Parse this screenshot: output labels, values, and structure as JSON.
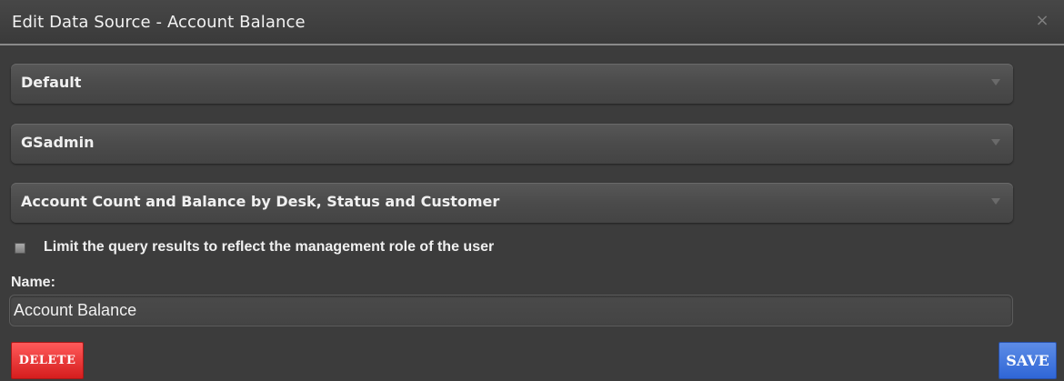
{
  "dialog": {
    "title": "Edit Data Source - Account Balance",
    "close_label": "×"
  },
  "selects": [
    {
      "value": "Default"
    },
    {
      "value": "GSadmin"
    },
    {
      "value": "Account Count and Balance by Desk, Status and Customer"
    }
  ],
  "limit_checkbox": {
    "label": "Limit the query results to reflect the management role of the user",
    "checked": false
  },
  "name_field": {
    "label": "Name:",
    "value": "Account Balance"
  },
  "buttons": {
    "delete_label": "DELETE",
    "save_label": "SAVE"
  },
  "colors": {
    "background": "#3c3c3c",
    "delete": "#e02a2a",
    "save": "#3b73dc"
  }
}
